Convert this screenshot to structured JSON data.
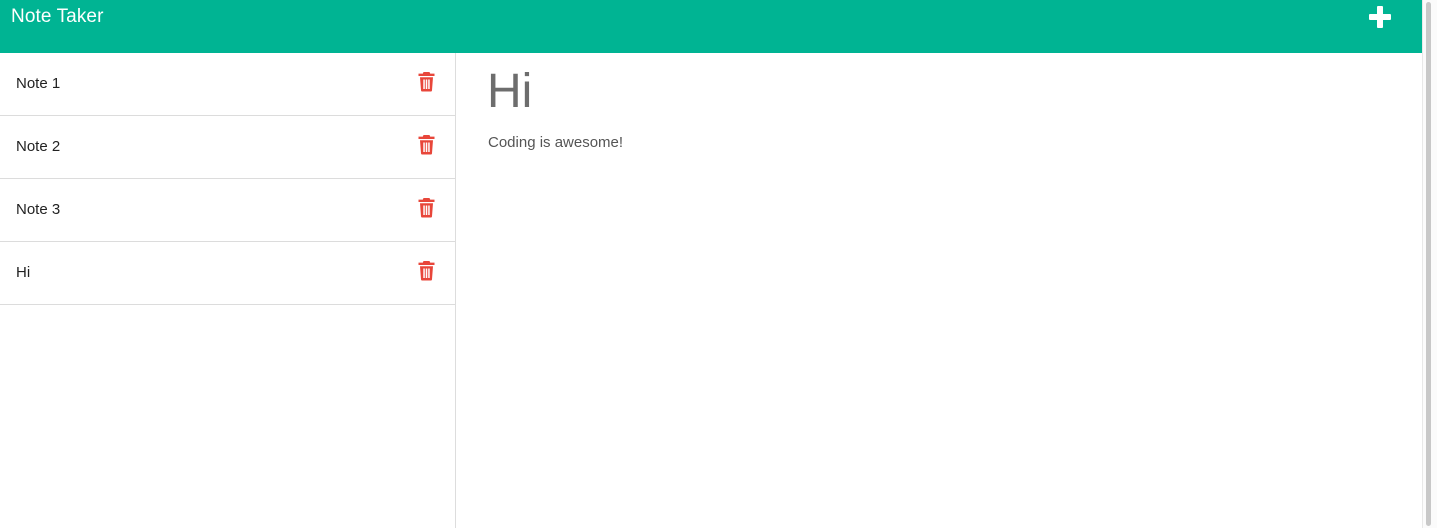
{
  "app": {
    "title": "Note Taker",
    "accent_color": "#00b493",
    "delete_color": "#e8463a"
  },
  "toolbar": {
    "new_note_icon": "plus-icon"
  },
  "sidebar": {
    "notes": [
      {
        "title": "Note 1",
        "delete_icon": "trash-icon"
      },
      {
        "title": "Note 2",
        "delete_icon": "trash-icon"
      },
      {
        "title": "Note 3",
        "delete_icon": "trash-icon"
      },
      {
        "title": "Hi",
        "delete_icon": "trash-icon"
      }
    ]
  },
  "main": {
    "note_title": "Hi",
    "note_text": "Coding is awesome!"
  }
}
